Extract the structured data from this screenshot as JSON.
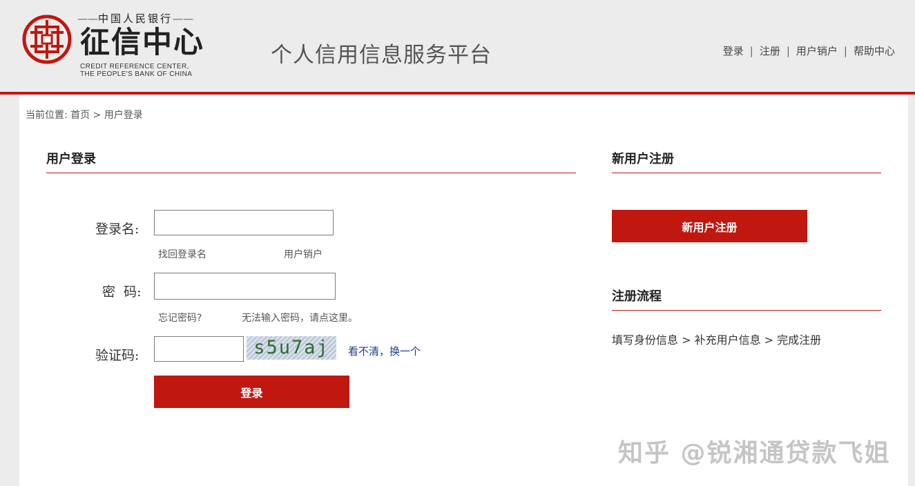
{
  "header": {
    "logo_top": "中国人民银行",
    "logo_main": "征信中心",
    "logo_en_line1": "CREDIT REFERENCE CENTER,",
    "logo_en_line2": "THE PEOPLE'S BANK OF CHINA",
    "platform_title": "个人信用信息服务平台",
    "nav": [
      {
        "label": "登录"
      },
      {
        "label": "注册"
      },
      {
        "label": "用户销户"
      },
      {
        "label": "帮助中心"
      }
    ]
  },
  "breadcrumb": {
    "prefix": "当前位置:",
    "home": "首页",
    "separator": ">",
    "current": "用户登录"
  },
  "login": {
    "title": "用户登录",
    "username_label": "登录名:",
    "username_value": "",
    "recover_username": "找回登录名",
    "cancel_account": "用户销户",
    "password_label": "密  码:",
    "password_value": "",
    "forgot_password": "忘记密码?",
    "cannot_input_password": "无法输入密码，请点这里。",
    "captcha_label": "验证码:",
    "captcha_value": "",
    "captcha_image_text": "s5u7aj",
    "captcha_refresh": "看不清，换一个",
    "submit_label": "登录"
  },
  "register": {
    "title": "新用户注册",
    "button_label": "新用户注册",
    "flow_title": "注册流程",
    "flow_text": "填写身份信息 > 补充用户信息 > 完成注册"
  },
  "watermark": "知乎 @锐湘通贷款飞姐",
  "colors": {
    "accent": "#c0170f",
    "link_blue": "#1b3e8e",
    "header_bg": "#ececec"
  }
}
